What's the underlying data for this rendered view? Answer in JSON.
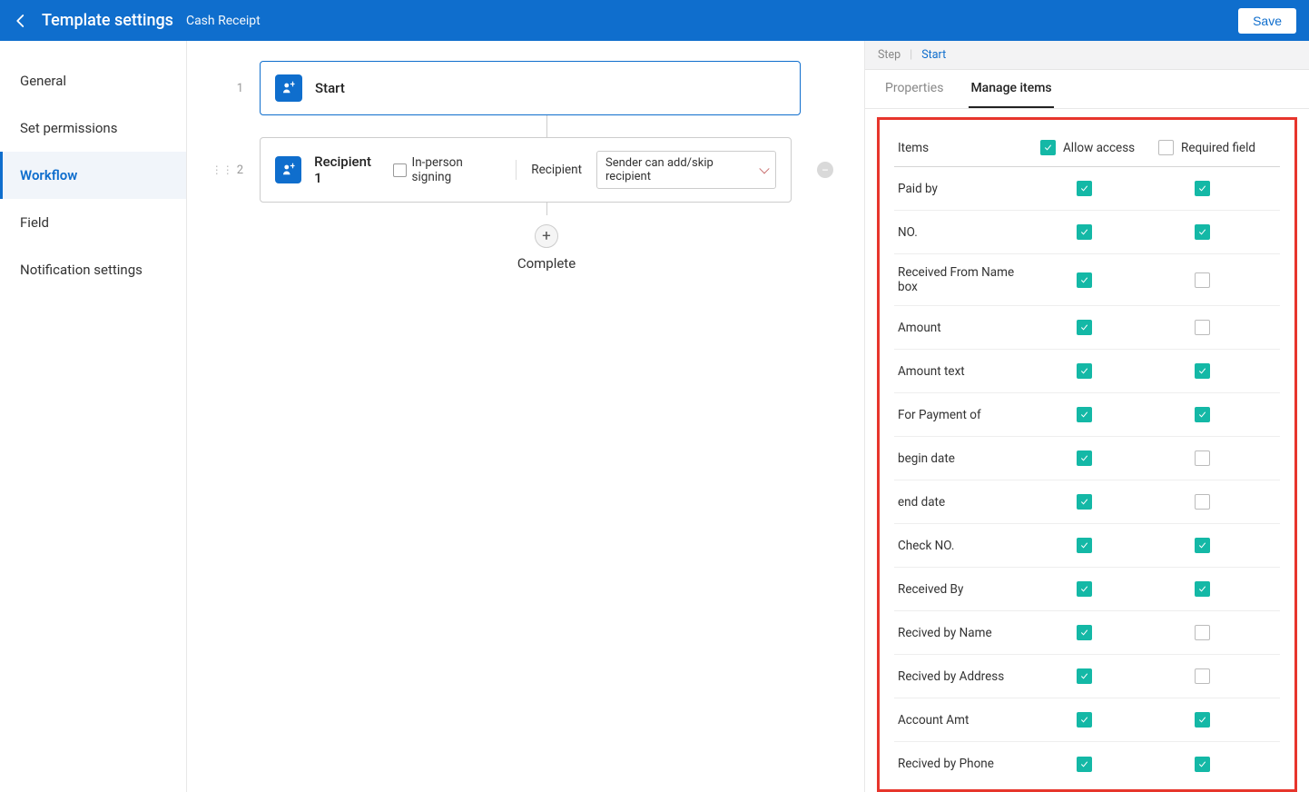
{
  "header": {
    "title": "Template settings",
    "subtitle": "Cash Receipt",
    "save_label": "Save"
  },
  "sidebar": {
    "items": [
      {
        "label": "General"
      },
      {
        "label": "Set permissions"
      },
      {
        "label": "Workflow"
      },
      {
        "label": "Field"
      },
      {
        "label": "Notification settings"
      }
    ],
    "active_index": 2
  },
  "workflow": {
    "steps": [
      {
        "number": "1",
        "title": "Start",
        "selected": true
      },
      {
        "number": "2",
        "title": "Recipient 1",
        "in_person_label": "In-person signing",
        "role_label": "Recipient",
        "select_value": "Sender can add/skip recipient",
        "has_drag": true
      }
    ],
    "add_icon": "+",
    "complete_label": "Complete"
  },
  "panel": {
    "breadcrumb": {
      "step_label": "Step",
      "current": "Start"
    },
    "tabs": [
      {
        "label": "Properties"
      },
      {
        "label": "Manage items"
      }
    ],
    "active_tab": 1,
    "columns": {
      "items": "Items",
      "allow_access": "Allow access",
      "required": "Required field"
    },
    "header_checks": {
      "allow_access": true,
      "required": false
    },
    "items": [
      {
        "name": "Paid by",
        "allow": true,
        "required": true
      },
      {
        "name": "NO.",
        "allow": true,
        "required": true
      },
      {
        "name": "Received From Name box",
        "allow": true,
        "required": false
      },
      {
        "name": "Amount",
        "allow": true,
        "required": false
      },
      {
        "name": "Amount text",
        "allow": true,
        "required": true
      },
      {
        "name": "For Payment of",
        "allow": true,
        "required": true
      },
      {
        "name": "begin date",
        "allow": true,
        "required": false
      },
      {
        "name": "end date",
        "allow": true,
        "required": false
      },
      {
        "name": "Check NO.",
        "allow": true,
        "required": true
      },
      {
        "name": "Received By",
        "allow": true,
        "required": true
      },
      {
        "name": "Recived by Name",
        "allow": true,
        "required": false
      },
      {
        "name": "Recived by Address",
        "allow": true,
        "required": false
      },
      {
        "name": "Account Amt",
        "allow": true,
        "required": true
      },
      {
        "name": "Recived by Phone",
        "allow": true,
        "required": true
      }
    ]
  }
}
